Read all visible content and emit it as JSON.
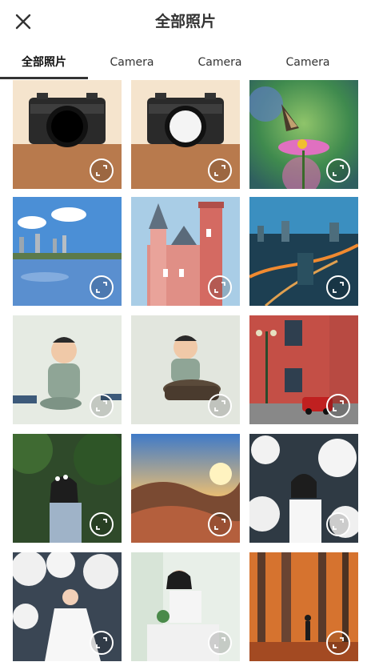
{
  "header": {
    "title": "全部照片"
  },
  "tabs": [
    {
      "label": "全部照片"
    },
    {
      "label": "Camera"
    },
    {
      "label": "Camera"
    },
    {
      "label": "Camera"
    }
  ],
  "icons": {
    "close": "close-icon",
    "expand": "expand-icon"
  },
  "colors": {
    "accent": "#333333",
    "background": "#ffffff"
  }
}
